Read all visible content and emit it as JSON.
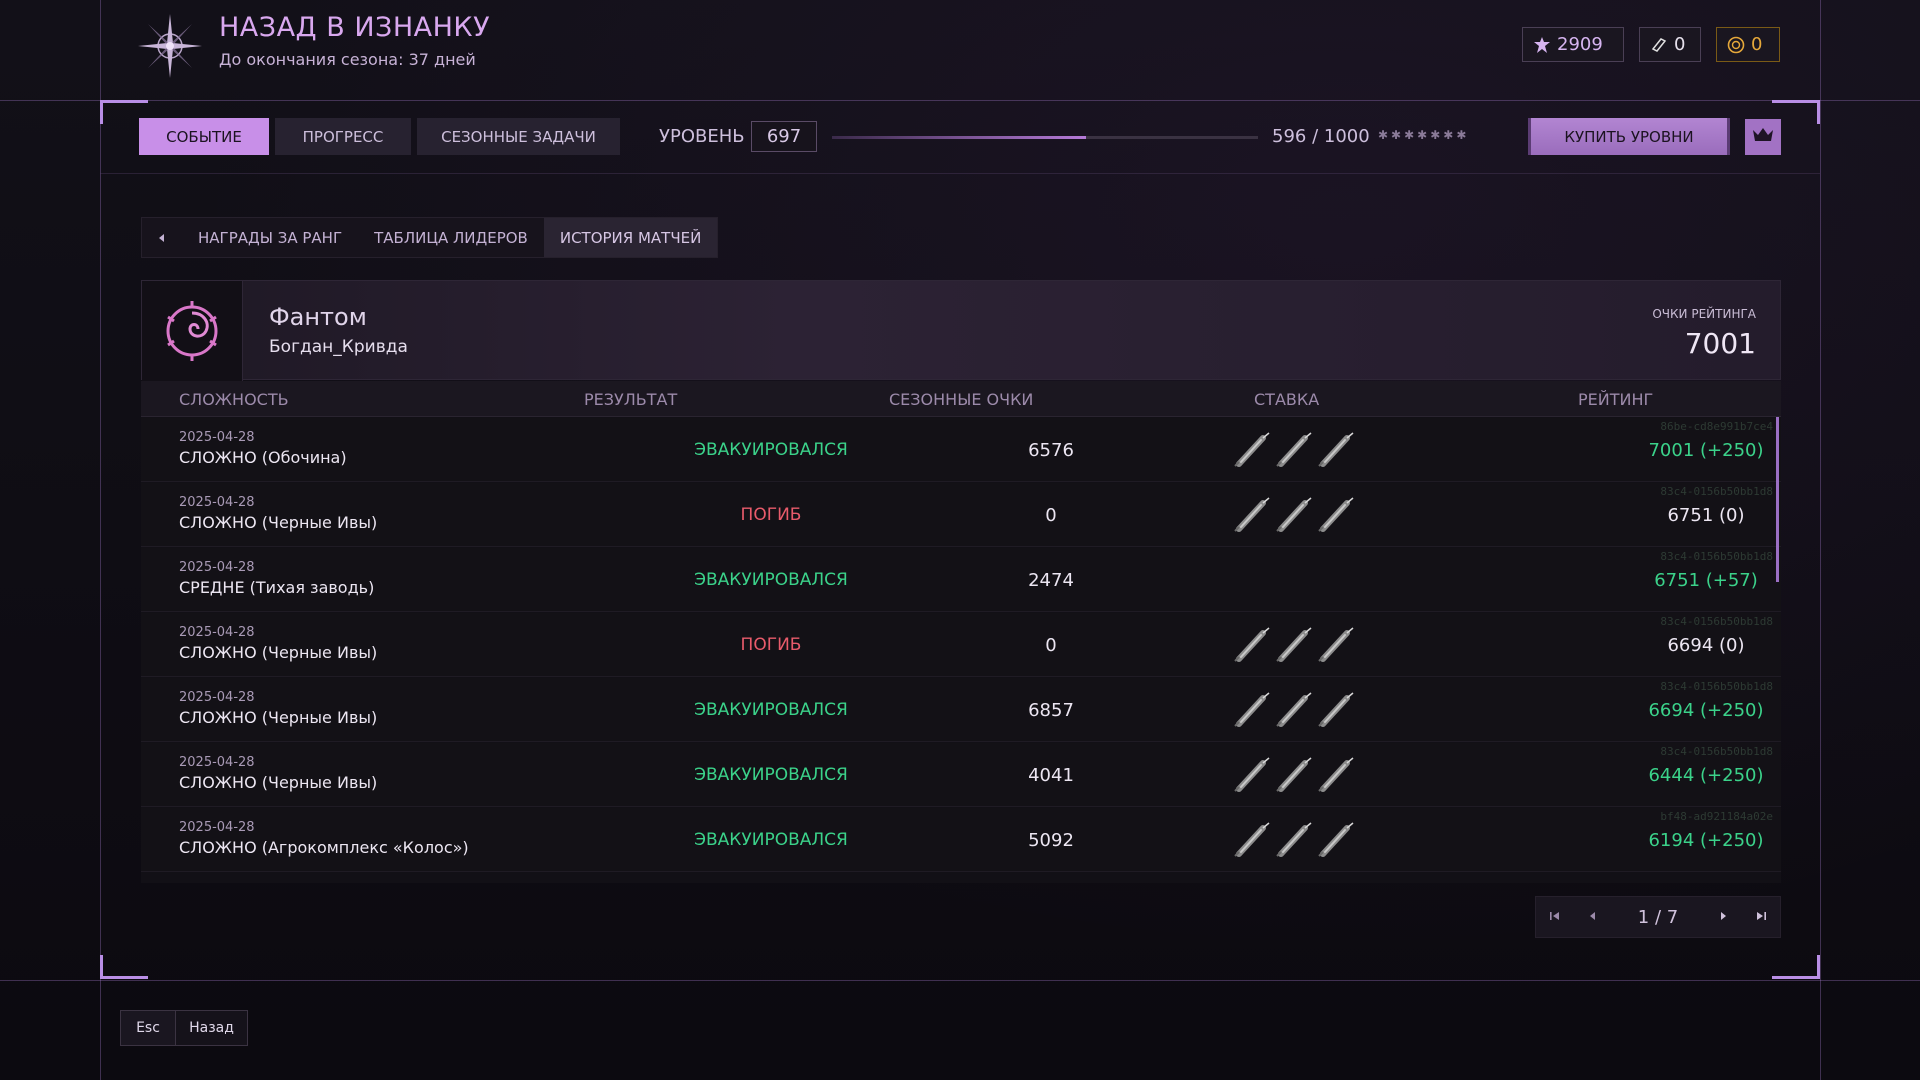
{
  "header": {
    "title": "НАЗАД В ИЗНАНКУ",
    "subtitle": "До окончания сезона: 37 дней",
    "currencies": [
      {
        "icon": "fragments-icon",
        "value": "2909",
        "color": "#d6b4f0"
      },
      {
        "icon": "tickets-icon",
        "value": "0",
        "color": "#e0e0e0"
      },
      {
        "icon": "coin-icon",
        "value": "0",
        "color": "#e6a83a"
      }
    ]
  },
  "nav": {
    "tabs": [
      {
        "label": "СОБЫТИЕ",
        "active": true
      },
      {
        "label": "ПРОГРЕСС",
        "active": false
      },
      {
        "label": "СЕЗОННЫЕ ЗАДАЧИ",
        "active": false
      }
    ],
    "level_label": "УРОВЕНЬ",
    "level_value": "697",
    "progress_text": "596 / 1000",
    "progress_fraction": 0.596,
    "stars": "✱✱✱✱✱✱✱",
    "buy_label": "КУПИТЬ УРОВНИ",
    "crown_icon": "crown-icon"
  },
  "subnav": {
    "back_icon": "chevron-left-icon",
    "tabs": [
      {
        "label": "НАГРАДЫ ЗА РАНГ",
        "active": false
      },
      {
        "label": "ТАБЛИЦА ЛИДЕРОВ",
        "active": false
      },
      {
        "label": "ИСТОРИЯ МАТЧЕЙ",
        "active": true
      }
    ]
  },
  "profile": {
    "name": "Фантом",
    "username": "Богдан_Кривда",
    "rating_label": "ОЧКИ РЕЙТИНГА",
    "rating_value": "7001"
  },
  "table": {
    "columns": [
      "СЛОЖНОСТЬ",
      "РЕЗУЛЬТАТ",
      "СЕЗОННЫЕ ОЧКИ",
      "СТАВКА",
      "РЕЙТИНГ"
    ],
    "rows": [
      {
        "date": "2025-04-28",
        "difficulty": "СЛОЖНО (Обочина)",
        "result": "ЭВАКУИРОВАЛСЯ",
        "result_type": "ok",
        "points": "6576",
        "stake": 3,
        "rating": "7001 (+250)",
        "rating_type": "green",
        "hash": "86be-cd8e991b7ce4"
      },
      {
        "date": "2025-04-28",
        "difficulty": "СЛОЖНО (Черные Ивы)",
        "result": "ПОГИБ",
        "result_type": "dead",
        "points": "0",
        "stake": 3,
        "rating": "6751 (0)",
        "rating_type": "white",
        "hash": "83c4-0156b50bb1d8"
      },
      {
        "date": "2025-04-28",
        "difficulty": "СРЕДНЕ (Тихая заводь)",
        "result": "ЭВАКУИРОВАЛСЯ",
        "result_type": "ok",
        "points": "2474",
        "stake": 0,
        "rating": "6751 (+57)",
        "rating_type": "green",
        "hash": "83c4-0156b50bb1d8"
      },
      {
        "date": "2025-04-28",
        "difficulty": "СЛОЖНО (Черные Ивы)",
        "result": "ПОГИБ",
        "result_type": "dead",
        "points": "0",
        "stake": 3,
        "rating": "6694 (0)",
        "rating_type": "white",
        "hash": "83c4-0156b50bb1d8"
      },
      {
        "date": "2025-04-28",
        "difficulty": "СЛОЖНО (Черные Ивы)",
        "result": "ЭВАКУИРОВАЛСЯ",
        "result_type": "ok",
        "points": "6857",
        "stake": 3,
        "rating": "6694 (+250)",
        "rating_type": "green",
        "hash": "83c4-0156b50bb1d8"
      },
      {
        "date": "2025-04-28",
        "difficulty": "СЛОЖНО (Черные Ивы)",
        "result": "ЭВАКУИРОВАЛСЯ",
        "result_type": "ok",
        "points": "4041",
        "stake": 3,
        "rating": "6444 (+250)",
        "rating_type": "green",
        "hash": "83c4-0156b50bb1d8"
      },
      {
        "date": "2025-04-28",
        "difficulty": "СЛОЖНО (Агрокомплекс «Колос»)",
        "result": "ЭВАКУИРОВАЛСЯ",
        "result_type": "ok",
        "points": "5092",
        "stake": 3,
        "rating": "6194 (+250)",
        "rating_type": "green",
        "hash": "bf48-ad921184a02e"
      }
    ]
  },
  "pagination": {
    "page_text": "1 / 7",
    "icons": [
      "first-page-icon",
      "prev-page-icon",
      "next-page-icon",
      "last-page-icon"
    ]
  },
  "footer": {
    "key": "Esc",
    "label": "Назад"
  },
  "colors": {
    "accent": "#c88fe8",
    "success": "#3bd28a",
    "danger": "#e85b6b"
  }
}
